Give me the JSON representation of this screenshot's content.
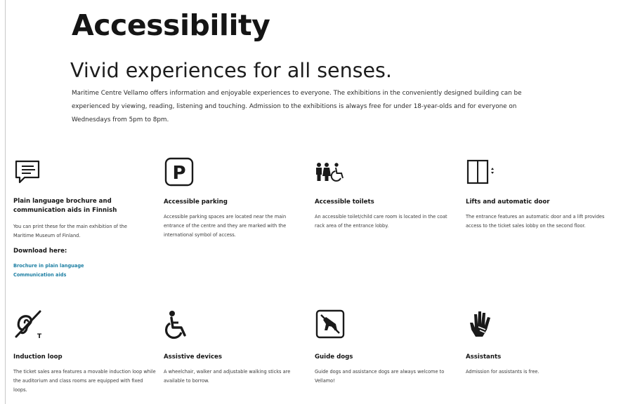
{
  "page": {
    "title": "Accessibility",
    "tagline": "Vivid experiences for all senses.",
    "intro": "Maritime Centre Vellamo offers information and enjoyable experiences to everyone. The exhibitions in the conveniently designed building can be experienced by viewing, reading, listening and touching. Admission to the exhibitions is always free for under 18-year-olds and for everyone on Wednesdays from 5pm to 8pm."
  },
  "features": [
    {
      "icon": "speech-bubble-icon",
      "title": "Plain language brochure and communication aids in Finnish",
      "text": "You can print these for the main exhibition of the Maritime Museum of Finland.",
      "download_heading": "Download here:",
      "links": [
        "Brochure in plain language",
        "Communication aids"
      ]
    },
    {
      "icon": "parking-icon",
      "title": "Accessible parking",
      "text": "Accessible parking spaces are located near the main entrance of the centre and they are marked with the international symbol of access."
    },
    {
      "icon": "toilets-icon",
      "title": "Accessible toilets",
      "text": "An accessible toilet/child care room is located in the coat rack area of the entrance lobby."
    },
    {
      "icon": "lift-icon",
      "title": "Lifts and automatic door",
      "text": "The entrance features an automatic door and a lift provides access to the ticket sales lobby on the second floor."
    },
    {
      "icon": "induction-loop-icon",
      "title": "Induction loop",
      "text": "The ticket sales area features a movable induction loop while the auditorium and class rooms are equipped with fixed loops."
    },
    {
      "icon": "wheelchair-icon",
      "title": "Assistive devices",
      "text": "A wheelchair, walker and adjustable walking sticks are available to borrow."
    },
    {
      "icon": "guide-dog-icon",
      "title": "Guide dogs",
      "text": "Guide dogs and assistance dogs are always welcome to Vellamo!"
    },
    {
      "icon": "sign-language-hand-icon",
      "title": "Assistants",
      "text": "Admission for assistants is free."
    }
  ],
  "colors": {
    "text": "#151515",
    "link": "#1d7fa3",
    "body_text": "#3a3a3a"
  }
}
